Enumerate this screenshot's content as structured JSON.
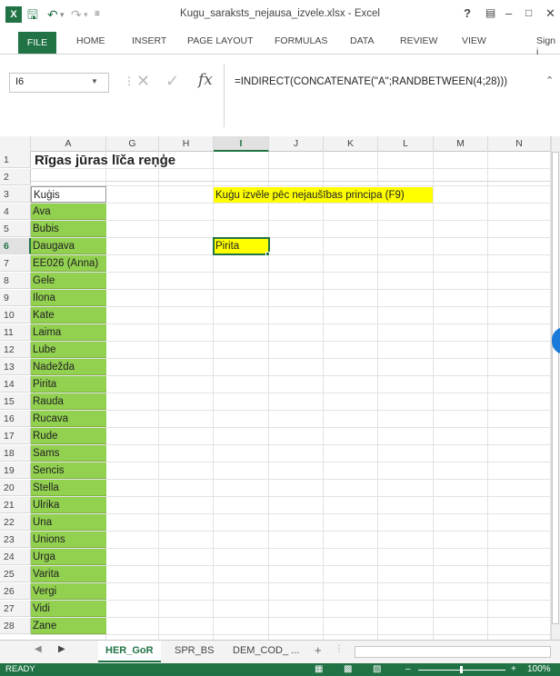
{
  "window": {
    "title": "Kugu_saraksts_nejausa_izvele.xlsx - Excel",
    "help": "?",
    "app_logo": "X"
  },
  "ribbon": {
    "tabs": [
      "FILE",
      "HOME",
      "INSERT",
      "PAGE LAYOUT",
      "FORMULAS",
      "DATA",
      "REVIEW",
      "VIEW"
    ],
    "sign_in": "Sign i"
  },
  "formula_bar": {
    "name_box": "I6",
    "formula": "=INDIRECT(CONCATENATE(\"A\";RANDBETWEEN(4;28)))"
  },
  "grid": {
    "columns": [
      "A",
      "G",
      "H",
      "I",
      "J",
      "K",
      "L",
      "M",
      "N"
    ],
    "active_column": "I",
    "active_row": "6",
    "rows": [
      "1",
      "2",
      "3",
      "4",
      "5",
      "6",
      "7",
      "8",
      "9",
      "10",
      "11",
      "12",
      "13",
      "14",
      "15",
      "16",
      "17",
      "18",
      "19",
      "20",
      "21",
      "22",
      "23",
      "24",
      "25",
      "26",
      "27",
      "28"
    ],
    "title": "Rīgas jūras līča reņģe",
    "list_header": "Kuģis",
    "ships": [
      "Ava",
      "Bubis",
      "Daugava",
      "EE026 (Anna)",
      "Gele",
      "Ilona",
      "Kate",
      "Laima",
      "Lube",
      "Nadežda",
      "Pirita",
      "Rauda",
      "Rucava",
      "Rude",
      "Sams",
      "Sencis",
      "Stella",
      "Ulrika",
      "Una",
      "Unions",
      "Urga",
      "Varita",
      "Vergi",
      "Vidi",
      "Zane"
    ],
    "note": "Kuģu izvēle pēc nejaušības principa (F9)",
    "selected_value": "Pirita"
  },
  "sheets": {
    "tabs": [
      "HER_GoR",
      "SPR_BS",
      "DEM_COD_ ..."
    ],
    "active": "HER_GoR",
    "add": "+"
  },
  "status": {
    "ready": "READY",
    "zoom": "100%"
  },
  "colors": {
    "excel_green": "#217346",
    "cell_green": "#92d050",
    "highlight_yellow": "#ffff00"
  }
}
